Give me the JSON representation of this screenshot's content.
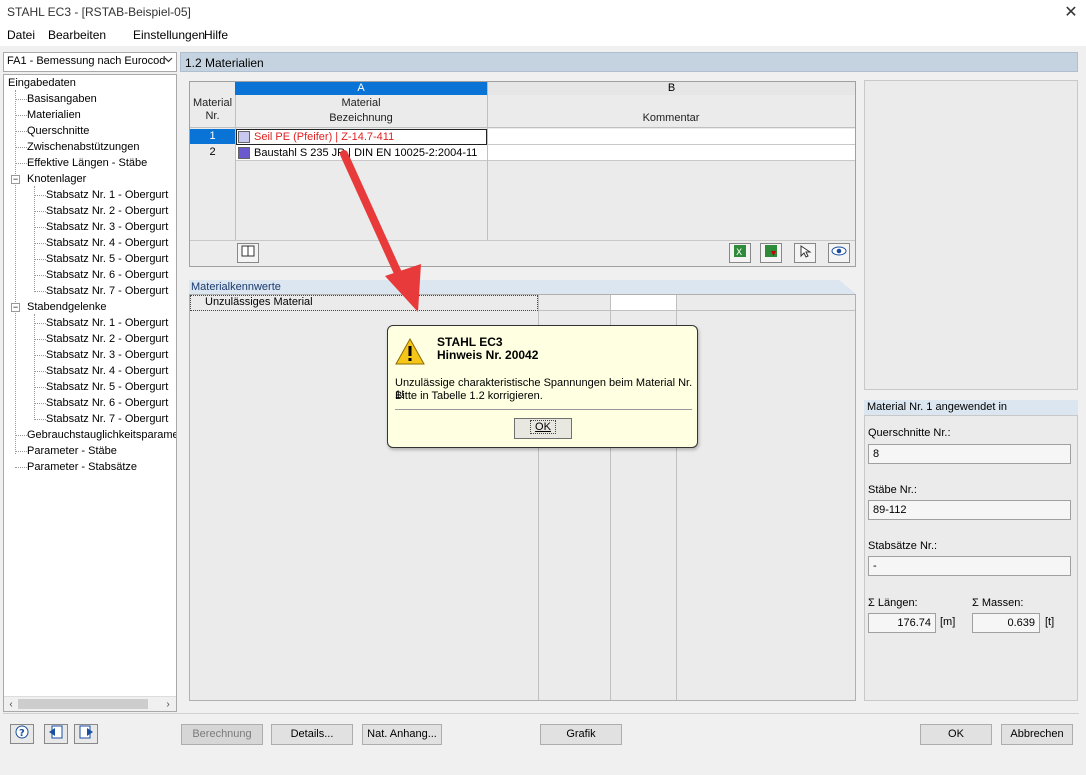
{
  "window": {
    "title": "STAHL EC3 - [RSTAB-Beispiel-05]",
    "close_glyph": "✕"
  },
  "menu": [
    "Datei",
    "Bearbeiten",
    "Einstellungen",
    "Hilfe"
  ],
  "left": {
    "combo_value": "FA1 - Bemessung nach Eurocod",
    "tree": {
      "root": "Eingabedaten",
      "items": [
        "Basisangaben",
        "Materialien",
        "Querschnitte",
        "Zwischenabstützungen",
        "Effektive Längen - Stäbe"
      ],
      "knotenlager": "Knotenlager",
      "knotenlager_children": [
        "Stabsatz Nr. 1 - Obergurt",
        "Stabsatz Nr. 2 - Obergurt",
        "Stabsatz Nr. 3 - Obergurt",
        "Stabsatz Nr. 4 - Obergurt",
        "Stabsatz Nr. 5 - Obergurt",
        "Stabsatz Nr. 6 - Obergurt",
        "Stabsatz Nr. 7 - Obergurt"
      ],
      "stabendgelenke": "Stabendgelenke",
      "stabendgelenke_children": [
        "Stabsatz Nr. 1 - Obergurt",
        "Stabsatz Nr. 2 - Obergurt",
        "Stabsatz Nr. 3 - Obergurt",
        "Stabsatz Nr. 4 - Obergurt",
        "Stabsatz Nr. 5 - Obergurt",
        "Stabsatz Nr. 6 - Obergurt",
        "Stabsatz Nr. 7 - Obergurt"
      ],
      "tail": [
        "Gebrauchstauglichkeitsparamet",
        "Parameter - Stäbe",
        "Parameter - Stabsätze"
      ],
      "toggle_minus": "−"
    }
  },
  "panel": {
    "title": "1.2 Materialien",
    "table": {
      "col_a_letter": "A",
      "col_b_letter": "B",
      "rownum_header_1": "Material",
      "rownum_header_2": "Nr.",
      "col_a_header_1": "Material",
      "col_a_header_2": "Bezeichnung",
      "col_b_header": "Kommentar",
      "rows": [
        {
          "nr": "1",
          "name": "Seil PE (Pfeifer) | Z-14.7-411",
          "color": "#c8c8f0",
          "text_color": "#e02020"
        },
        {
          "nr": "2",
          "name": "Baustahl S 235 JR | DIN EN 10025-2:2004-11",
          "color": "#6a5acd",
          "text_color": "#000000"
        }
      ]
    },
    "kennwerte": {
      "title": "Materialkennwerte",
      "row_label": "Unzulässiges Material"
    }
  },
  "right": {
    "info_title": "Material Nr. 1 angewendet in",
    "querschnitte_label": "Querschnitte Nr.:",
    "querschnitte_value": "8",
    "staebe_label": "Stäbe Nr.:",
    "staebe_value": "89-112",
    "stabsaetze_label": "Stabsätze Nr.:",
    "stabsaetze_value": "-",
    "laengen_label": "Σ Längen:",
    "laengen_value": "176.74",
    "laengen_unit": "[m]",
    "massen_label": "Σ Massen:",
    "massen_value": "0.639",
    "massen_unit": "[t]"
  },
  "buttons": {
    "berechnung": "Berechnung",
    "details": "Details...",
    "nat_anhang": "Nat. Anhang...",
    "grafik": "Grafik",
    "ok": "OK",
    "abbrechen": "Abbrechen"
  },
  "dialog": {
    "title": "STAHL EC3",
    "subtitle": "Hinweis Nr. 20042",
    "message_1": "Unzulässige charakteristische Spannungen beim Material Nr. 1!",
    "message_2": "Bitte in Tabelle 1.2 korrigieren.",
    "ok": "OK"
  }
}
